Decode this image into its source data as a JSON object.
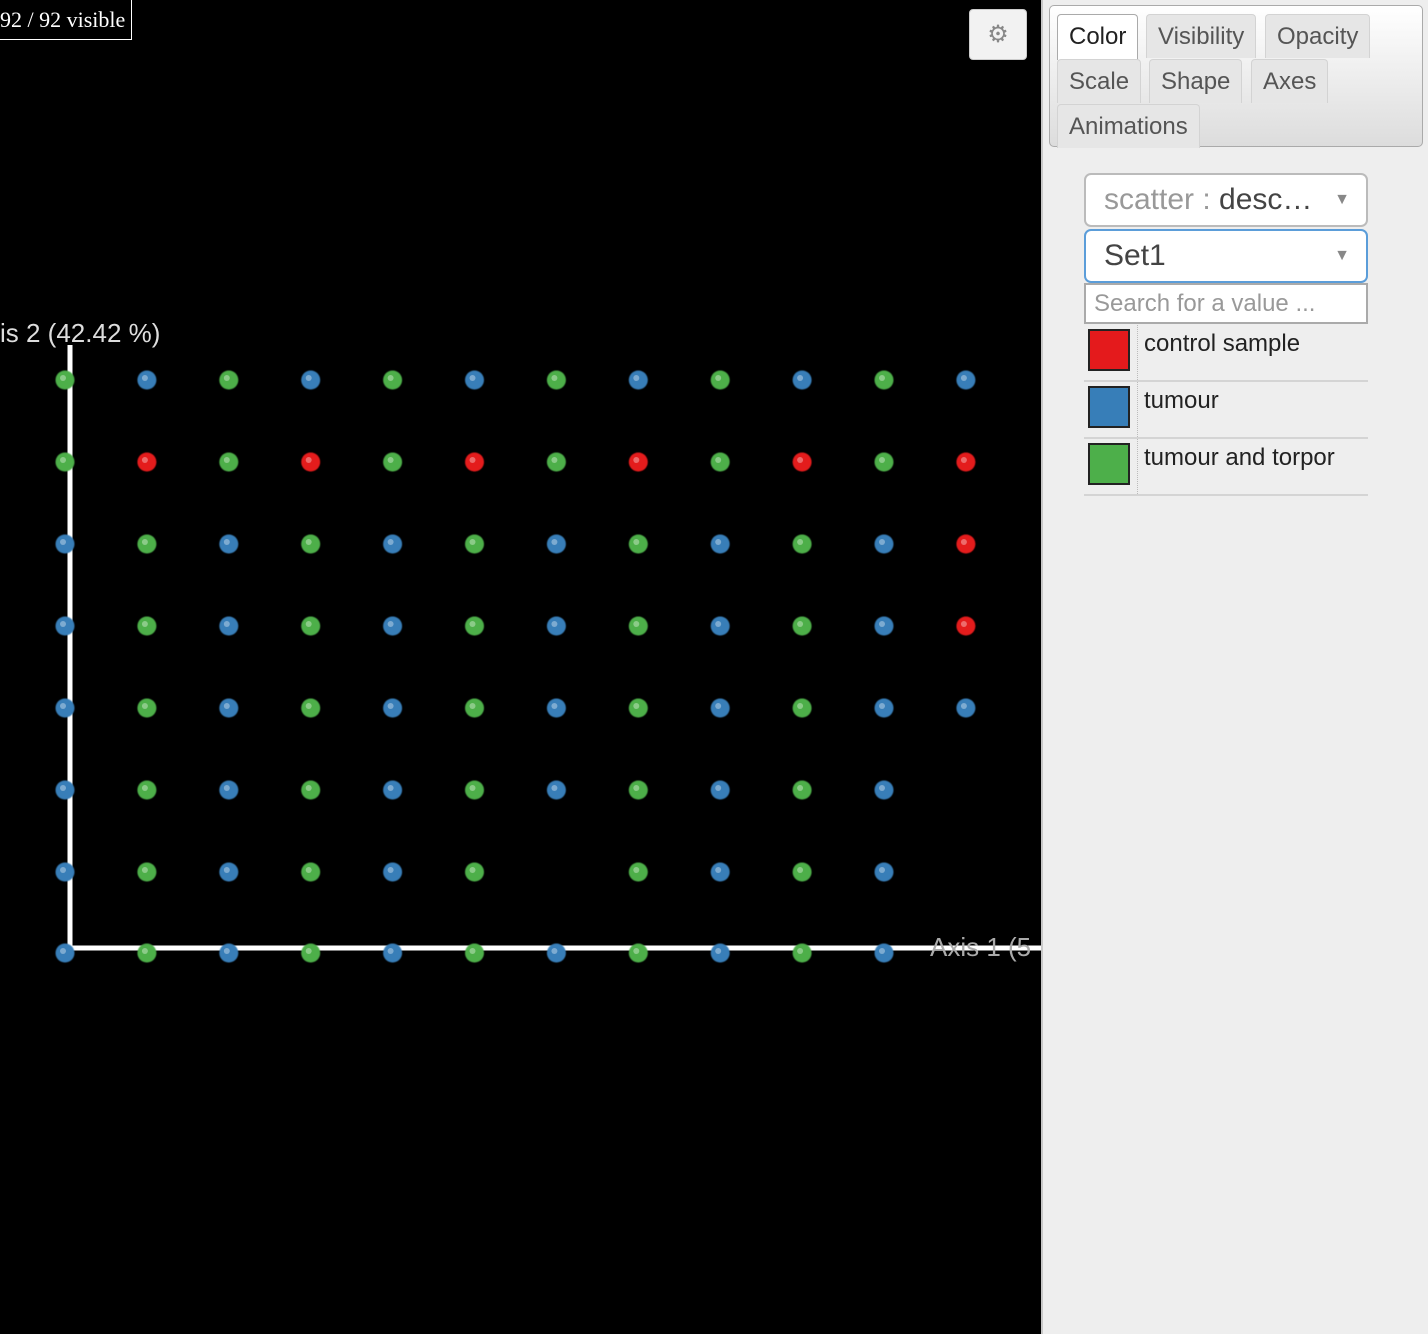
{
  "counter": "92 / 92 visible",
  "settings_icon": "gear-icon",
  "tabs": [
    "Color",
    "Visibility",
    "Opacity",
    "Scale",
    "Shape",
    "Axes",
    "Animations"
  ],
  "active_tab": "Color",
  "scatter_select": {
    "prefix": "scatter",
    "value": "desc…"
  },
  "palette_select": {
    "value": "Set1"
  },
  "search": {
    "placeholder": "Search for a value ..."
  },
  "legend": [
    {
      "label": "control sample",
      "color": "#e41a1c"
    },
    {
      "label": "tumour",
      "color": "#377eb8"
    },
    {
      "label": "tumour and torpor",
      "color": "#4daf4a"
    }
  ],
  "chart_data": {
    "type": "scatter",
    "ylabel": "is 2 (42.42 %)",
    "xlabel": "Axis 1 (5",
    "grid": false,
    "legend_placement": "right panel",
    "point_grid": {
      "columns": 12,
      "rows": [
        "GBGBGBGBGBGB",
        "GRGRGRGRGRGR",
        "BGBGBGBGBGBR",
        "BGBGBGBGBGBR",
        "BGBGBGBGBGBB",
        "BGBGBGBGBGB.",
        "BGBGBG.GBGB.",
        "BGBGBGBGBGB."
      ],
      "codes": {
        "R": "control sample",
        "B": "tumour",
        "G": "tumour and torpor"
      }
    }
  }
}
